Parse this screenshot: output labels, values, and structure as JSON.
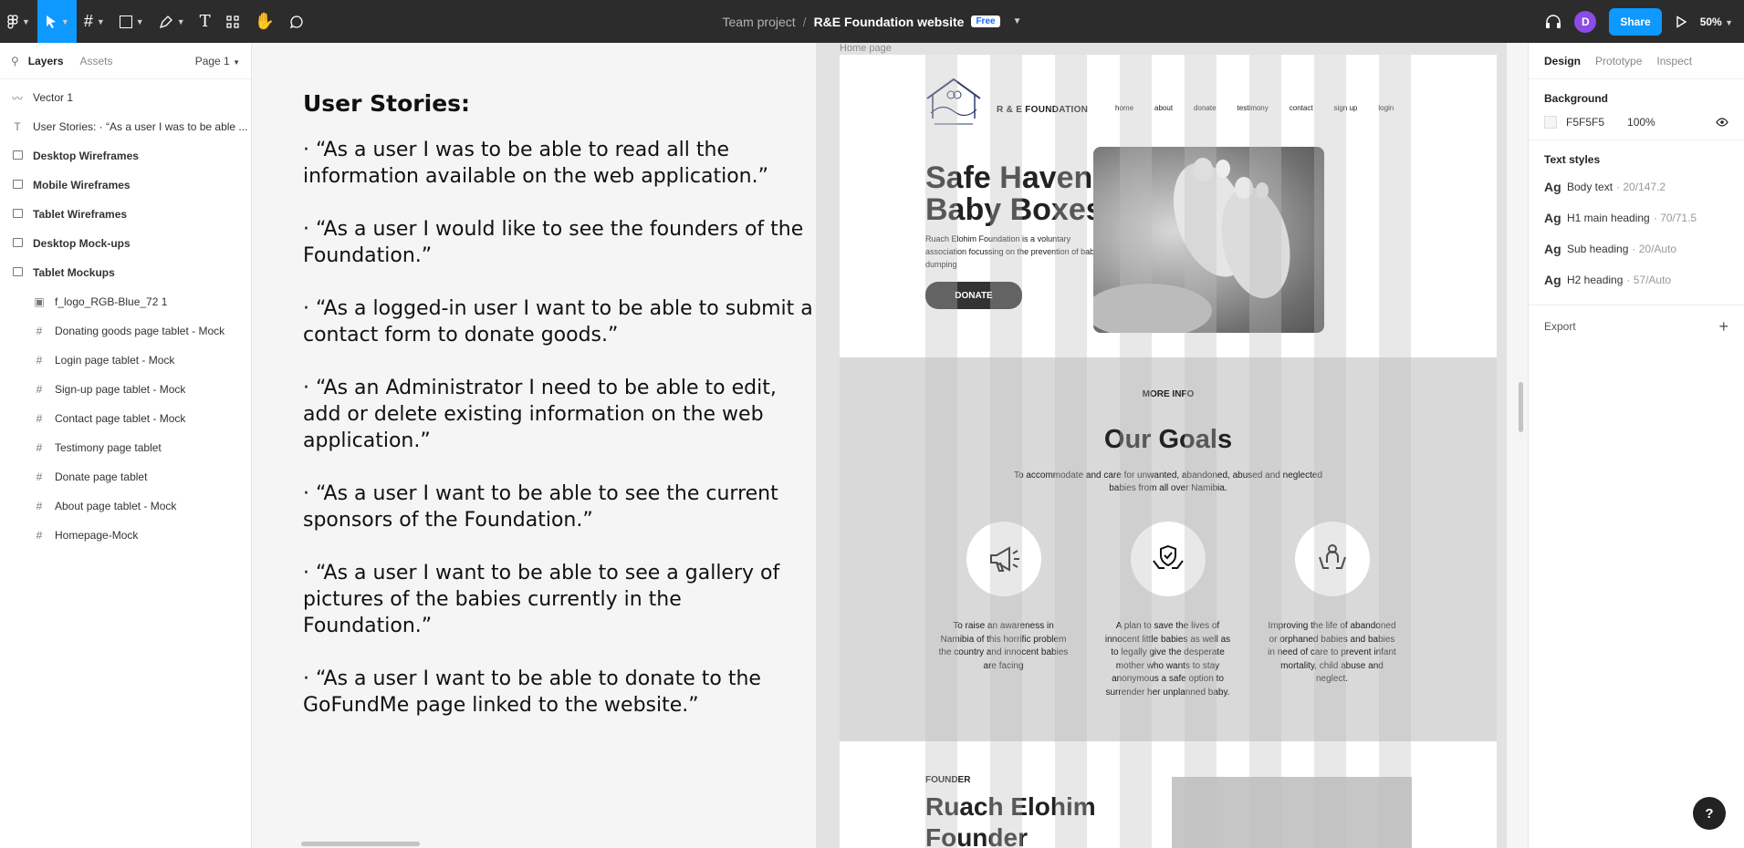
{
  "toolbar": {
    "project": "Team project",
    "separator": "/",
    "file_name": "R&E Foundation website",
    "plan_badge": "Free",
    "avatar_initial": "D",
    "share_label": "Share",
    "zoom": "50%"
  },
  "left_panel": {
    "tab_layers": "Layers",
    "tab_assets": "Assets",
    "page_selector": "Page 1",
    "layers": [
      {
        "label": "Vector 1",
        "icon": "vector-icon",
        "level": 0,
        "bold": false
      },
      {
        "label": "User Stories: · “As a user I was to be able ...",
        "icon": "text-icon",
        "level": 0,
        "bold": false
      },
      {
        "label": "Desktop Wireframes",
        "icon": "section-icon",
        "level": 0,
        "bold": true
      },
      {
        "label": "Mobile Wireframes",
        "icon": "section-icon",
        "level": 0,
        "bold": true
      },
      {
        "label": "Tablet Wireframes",
        "icon": "section-icon",
        "level": 0,
        "bold": true
      },
      {
        "label": "Desktop Mock-ups",
        "icon": "section-icon",
        "level": 0,
        "bold": true
      },
      {
        "label": "Tablet Mockups",
        "icon": "section-icon",
        "level": 0,
        "bold": true
      },
      {
        "label": "f_logo_RGB-Blue_72 1",
        "icon": "image-icon",
        "level": 1,
        "bold": false
      },
      {
        "label": "Donating goods page tablet - Mock",
        "icon": "frame-hash-icon",
        "level": 1,
        "bold": false
      },
      {
        "label": "Login page tablet - Mock",
        "icon": "frame-hash-icon",
        "level": 1,
        "bold": false
      },
      {
        "label": "Sign-up page tablet - Mock",
        "icon": "frame-hash-icon",
        "level": 1,
        "bold": false
      },
      {
        "label": "Contact page tablet - Mock",
        "icon": "frame-hash-icon",
        "level": 1,
        "bold": false
      },
      {
        "label": "Testimony page tablet",
        "icon": "frame-hash-icon",
        "level": 1,
        "bold": false
      },
      {
        "label": "Donate page tablet",
        "icon": "frame-hash-icon",
        "level": 1,
        "bold": false
      },
      {
        "label": "About page tablet -  Mock",
        "icon": "frame-hash-icon",
        "level": 1,
        "bold": false
      },
      {
        "label": "Homepage-Mock",
        "icon": "frame-hash-icon",
        "level": 1,
        "bold": false
      }
    ]
  },
  "canvas": {
    "stories_title": "User Stories:",
    "stories": [
      "· “As a user I was to be able to read all the information available on the web application.”",
      "· “As a user I would like to see the founders of the Foundation.”",
      "· “As a logged-in user I want to be able to submit a contact form to donate goods.”",
      "· “As an Administrator I need to be able to edit, add or delete existing information on the web application.”",
      "· “As a user I want to be able to see the current sponsors of the Foundation.”",
      "· “As a user I want to be able to see a gallery of pictures of the babies currently in the Foundation.”",
      "· “As a user I want to be able to donate to the GoFundMe page linked to the website.”"
    ],
    "frame_label": "Home page",
    "mock": {
      "brand": "R & E FOUNDATION",
      "nav": [
        "home",
        "about",
        "donate",
        "testimony",
        "contact",
        "sign up",
        "login"
      ],
      "hero_title": "Safe Haven Baby Boxes",
      "hero_text": "Ruach Elohim Foundation is a voluntary association focussing on the prevention of baby dumping",
      "donate_label": "DONATE",
      "more_info": "MORE INFO",
      "goals_title": "Our Goals",
      "goals_sub": "To accommodate and care for unwanted, abandoned, abused and neglected babies from all over Namibia.",
      "goals": [
        "To raise an awareness in Namibia of this horrific problem the country and innocent babies are facing",
        "A plan to save the lives of innocent little babies as well as to legally give the desperate mother who wants to stay anonymous a safe option to surrender her unplanned baby.",
        "Improving the life of abandoned or orphaned babies and babies in need of care to prevent infant mortality, child abuse and neglect."
      ],
      "founder_kicker": "FOUNDER",
      "founder_title": "Ruach Elohim Founder"
    }
  },
  "right_panel": {
    "tabs": [
      "Design",
      "Prototype",
      "Inspect"
    ],
    "background_heading": "Background",
    "background_hex": "F5F5F5",
    "background_opacity": "100%",
    "text_styles_heading": "Text styles",
    "text_styles": [
      {
        "sample": "Ag",
        "name": "Body text",
        "meta": "· 20/147.2"
      },
      {
        "sample": "Ag",
        "name": "H1 main heading",
        "meta": "· 70/71.5"
      },
      {
        "sample": "Ag",
        "name": "Sub heading",
        "meta": "· 20/Auto"
      },
      {
        "sample": "Ag",
        "name": "H2 heading",
        "meta": "· 57/Auto"
      }
    ],
    "export_label": "Export",
    "help_label": "?"
  }
}
